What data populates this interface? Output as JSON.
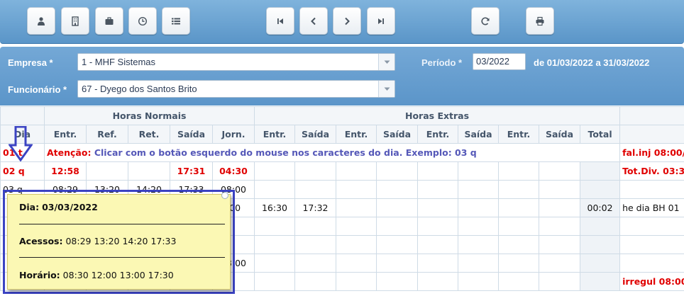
{
  "toolbar": {
    "buttons": [
      {
        "icon": "user-icon"
      },
      {
        "icon": "building-icon"
      },
      {
        "icon": "briefcase-icon"
      },
      {
        "icon": "clock-icon"
      },
      {
        "icon": "list-icon"
      },
      {
        "icon": "first-page-icon"
      },
      {
        "icon": "previous-icon"
      },
      {
        "icon": "next-icon"
      },
      {
        "icon": "last-page-icon"
      },
      {
        "icon": "refresh-icon"
      },
      {
        "icon": "print-icon"
      }
    ]
  },
  "form": {
    "empresa_label": "Empresa *",
    "empresa_value": "1 - MHF Sistemas",
    "periodo_label": "Período *",
    "periodo_value": "03/2022",
    "periodo_range": "de 01/03/2022 a 31/03/2022",
    "funcionario_label": "Funcionário *",
    "funcionario_value": "67 - Dyego dos Santos Brito"
  },
  "table": {
    "group_normais": "Horas Normais",
    "group_extras": "Horas Extras",
    "columns": [
      "Dia",
      "Entr.",
      "Ref.",
      "Ret.",
      "Saída",
      "Jorn.",
      "Entr.",
      "Saída",
      "Entr.",
      "Saída",
      "Entr.",
      "Saída",
      "Entr.",
      "Saída",
      "Total"
    ],
    "row1": {
      "dia": "01 t",
      "message": "Atenção: Clicar com o botão esquerdo do mouse nos caracteres do dia. Exemplo: 03 q",
      "note": "fal.inj 08:00/"
    },
    "row2": {
      "dia": "02 q",
      "entr": "12:58",
      "saida": "17:31",
      "jorn": "04:30",
      "note": "Tot.Div. 03:3"
    },
    "row3": {
      "dia": "03 q",
      "entr": "08:29",
      "ref": "13:20",
      "ret": "14:20",
      "saida": "17:33",
      "jorn": "08:00"
    },
    "row4": {
      "jorn": ":00",
      "ex_entr": "16:30",
      "ex_saida": "17:32",
      "total": "00:02",
      "note": "he dia BH 01"
    },
    "row7": {
      "jorn": "08:00"
    },
    "row9": {
      "note": "irregul 08:00"
    }
  },
  "tooltip": {
    "dia_label": "Dia:",
    "dia_value": "03/03/2022",
    "acessos_label": "Acessos:",
    "acessos_value": "08:29 13:20 14:20 17:33",
    "horario_label": "Horário:",
    "horario_value": "08:30 12:00 13:00 17:30"
  },
  "colors": {
    "header_blue": "#5b95c9",
    "alert_red": "#e00000",
    "message_blue": "#5558b8",
    "highlight_border": "#3b43c2",
    "tooltip_bg": "#fbf8b4"
  }
}
